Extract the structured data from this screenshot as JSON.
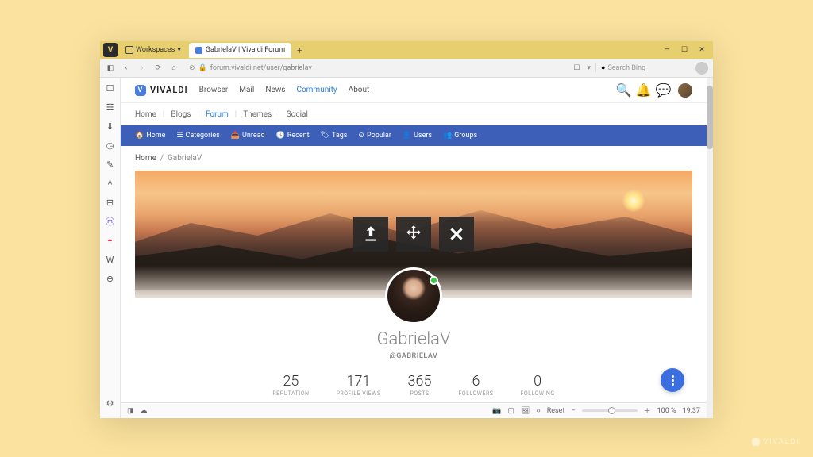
{
  "browser": {
    "workspaces_label": "Workspaces",
    "tab_title": "GabrielaV | Vivaldi Forum",
    "url": "forum.vivaldi.net/user/gabrielav",
    "search_placeholder": "Search Bing"
  },
  "site": {
    "brand": "VIVALDI",
    "top_nav": [
      "Browser",
      "Mail",
      "News",
      "Community",
      "About"
    ],
    "top_nav_active_index": 3,
    "sub_nav": [
      "Home",
      "Blogs",
      "Forum",
      "Themes",
      "Social"
    ],
    "sub_nav_active_index": 2
  },
  "forum_bar": {
    "items": [
      {
        "icon": "home",
        "label": "Home"
      },
      {
        "icon": "list",
        "label": "Categories"
      },
      {
        "icon": "inbox",
        "label": "Unread"
      },
      {
        "icon": "clock",
        "label": "Recent"
      },
      {
        "icon": "tag",
        "label": "Tags"
      },
      {
        "icon": "fire",
        "label": "Popular"
      },
      {
        "icon": "user",
        "label": "Users"
      },
      {
        "icon": "group",
        "label": "Groups"
      }
    ]
  },
  "breadcrumb": {
    "home": "Home",
    "current": "GabrielaV"
  },
  "profile": {
    "display_name": "GabrielaV",
    "handle": "@GABRIELAV",
    "stats": [
      {
        "value": "25",
        "label": "REPUTATION"
      },
      {
        "value": "171",
        "label": "PROFILE VIEWS"
      },
      {
        "value": "365",
        "label": "POSTS"
      },
      {
        "value": "6",
        "label": "FOLLOWERS"
      },
      {
        "value": "0",
        "label": "FOLLOWING"
      }
    ]
  },
  "statusbar": {
    "reset": "Reset",
    "zoom": "100 %",
    "time": "19:37"
  },
  "watermark": "VIVALDI"
}
